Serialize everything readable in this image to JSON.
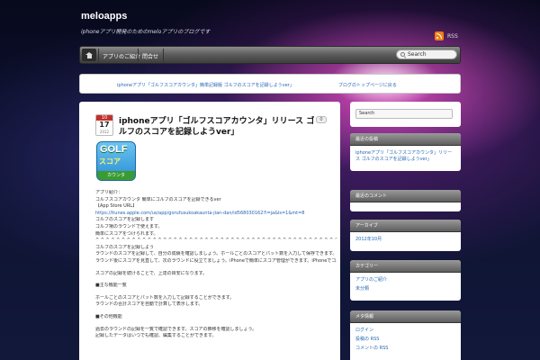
{
  "site": {
    "title": "meloapps",
    "description": "iphoneアプリ開発のためのmeloアプリのブログです"
  },
  "header": {
    "rss_label": "RSS"
  },
  "nav": {
    "items": [
      "アプリのご紹介",
      "問合せ"
    ],
    "search_placeholder": "Search"
  },
  "banner": {
    "links": [
      "iphoneアプリ「ゴルフスコアカウンタ」簡単記録版 ゴルフのスコアを記録しようver」",
      "ブログのトップページに戻る"
    ]
  },
  "post": {
    "date": {
      "month": "10",
      "day": "17",
      "year": "2012"
    },
    "title": "iphoneアプリ「ゴルフスコアカウンタ」リリース ゴルフのスコアを記録しようver」",
    "comment_count": "0",
    "icon": {
      "word": "GOLF",
      "kana": "スコア",
      "band": "カウンタ"
    },
    "lines": [
      "アプリ紹介：",
      "ゴルフスコアカウンタ 簡単にゴルフのスコアを記録できるver",
      "【App Store URL】",
      "https://itunes.apple.com/us/app/gorufusukoakaunta-jian-dan/id568030162?l=ja&ls=1&mt=8",
      "ゴルフのスコアを記録します",
      "ゴルフ場のラウンドで使えます。",
      "簡単にスコアをつけられます。",
      "^ ^ ^ ^ ^ ^ ^ ^ ^ ^ ^ ^ ^ ^ ^ ^ ^ ^ ^ ^ ^ ^ ^ ^ ^ ^ ^ ^ ^ ^ ^ ^ ^ ^ ^ ^ ^ ^ ^ ^ ^ ^ ^ ^ ^ ^ ^ ^ ^ ^ ^ ^ ^ ^ ^ ^ ^ ^ ^ ^ ^ ^ ^ ^ ^ ^ ^ ^ ^ ^ ^ ^ ^ ^ ^ ^ ^ ^ ^ ^ ^ ^ ^ ^ ^ ^ ^ ^ ^ ^ ^ ^ ^ ^ ^ ^ ^ ^ ^ ^ ^ ^ ^ ^ ^ ^ ^ ^ ^ ^ ^ ^ ^ ^ ^ ^ ^ ^ ^ ^ ^ ^ ^ ^ ^ ^ ^ ^ ^ ^ ^ ^ ^ ^ ^ ^ ^ ^ ^ ^ ^ ^ ^ ^ ^ ^ ^ ^ ^ ^",
      "ゴルフのスコアを記録しよう",
      "ラウンドのスコアを記録して、自分の成績を確認しましょう。ホールごとのスコアとパット数を入力して保存できます。…",
      "ラウンド後にスコアを見直して、次のラウンドに役立てましょう。iPhoneで簡単にスコア管理ができます。iPhoneでゴルフのスコアを管理しましょう。",
      "",
      "スコアの記録を続けることで、上達の目安になります。",
      "",
      "■主な機能一覧",
      "",
      "ホールごとのスコアとパット数を入力して記録することができます。",
      "ラウンドの合計スコアを自動で計算して表示します。",
      "",
      "■その他機能",
      "",
      "過去のラウンドの記録を一覧で確認できます。スコアの推移を確認しましょう。",
      "記録したデータはいつでも確認、編集することができます。"
    ]
  },
  "sidebar": {
    "search_placeholder": "Search",
    "widgets": [
      {
        "title": "最近の投稿",
        "items": [
          "iphoneアプリ「ゴルフスコアカウンタ」リリース ゴルフのスコアを記録しようver」"
        ]
      },
      {
        "title": "最近のコメント",
        "items": []
      },
      {
        "title": "アーカイブ",
        "items": [
          "2012年10月"
        ]
      },
      {
        "title": "カテゴリー",
        "items": [
          "アプリのご紹介",
          "未分類"
        ]
      },
      {
        "title": "メタ情報",
        "items": [
          "ログイン",
          "投稿の RSS",
          "コメントの RSS"
        ]
      }
    ]
  },
  "colors": {
    "link": "#2466b1",
    "date_month_bg": "#c4302b",
    "rss_orange": "#f07d14"
  }
}
